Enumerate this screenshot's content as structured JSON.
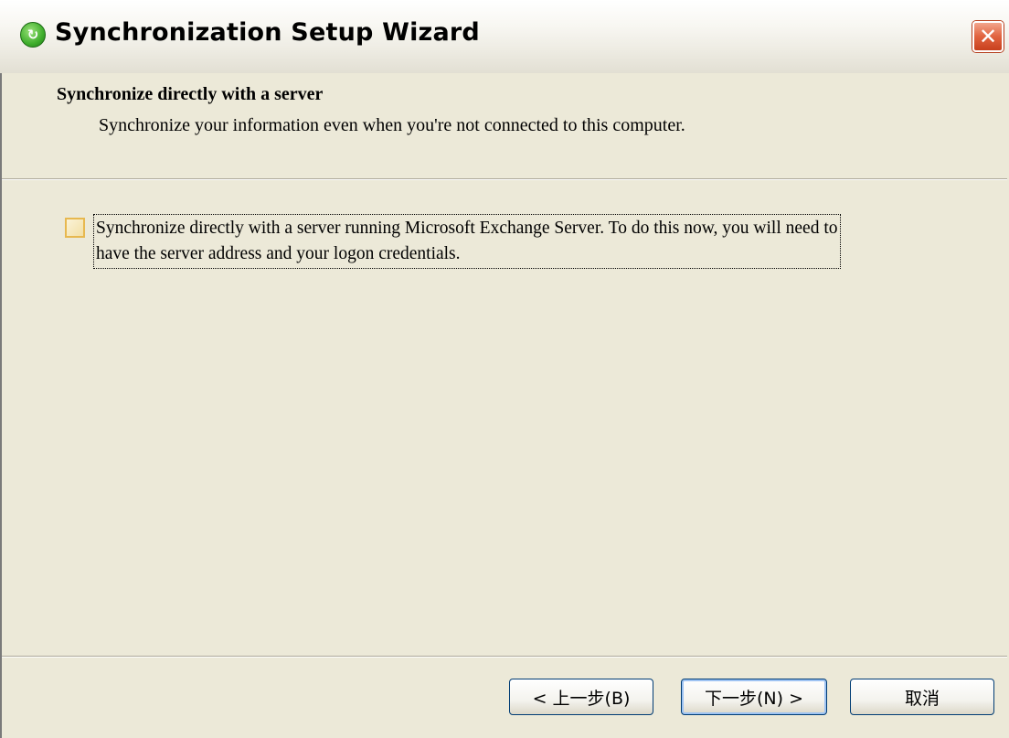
{
  "window": {
    "title": "Synchronization Setup Wizard",
    "app_icon": "sync-icon",
    "close_glyph": "✕"
  },
  "header": {
    "heading": "Synchronize directly with a server",
    "subheading": "Synchronize your information even when you're not connected to this computer."
  },
  "option": {
    "checked": false,
    "label": "Synchronize directly with a server running Microsoft Exchange Server.  To do this now, you will need to have the server address and your logon credentials."
  },
  "buttons": {
    "back_label": "< 上一步(B)",
    "next_label": "下一步(N) >",
    "cancel_label": "取消"
  },
  "colors": {
    "dialog_bg": "#ece9d8",
    "close_button": "#e1633f",
    "button_border": "#003c74",
    "checkbox_border": "#e7b84f"
  }
}
